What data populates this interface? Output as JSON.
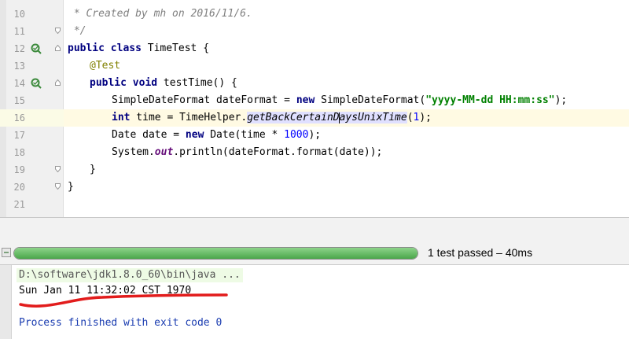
{
  "editor": {
    "lines": [
      {
        "num": "10",
        "comment": " * Created by mh on 2016/11/6."
      },
      {
        "num": "11",
        "comment": " */"
      },
      {
        "num": "12",
        "kw": "public class",
        "rest": " TimeTest {"
      },
      {
        "num": "13",
        "annotation": "@Test"
      },
      {
        "num": "14",
        "kw": "public void",
        "rest": " testTime() {"
      },
      {
        "num": "15",
        "pre": "SimpleDateFormat dateFormat = ",
        "kw": "new",
        "mid": " SimpleDateFormat(",
        "str": "\"yyyy-MM-dd HH:mm:ss\"",
        "post": ");"
      },
      {
        "num": "16",
        "kw": "int",
        "pre": " time = TimeHelper.",
        "method_a": "getBackCertainD",
        "method_b": "aysUnixTime",
        "mid": "(",
        "numval": "1",
        "post": ");"
      },
      {
        "num": "17",
        "pre": "Date date = ",
        "kw": "new",
        "mid": " Date(time * ",
        "numval": "1000",
        "post": ");"
      },
      {
        "num": "18",
        "pre": "System.",
        "static": "out",
        "post": ".println(dateFormat.format(date));"
      },
      {
        "num": "19",
        "rest": "}"
      },
      {
        "num": "20",
        "rest": "}"
      },
      {
        "num": "21"
      }
    ],
    "gutter_icon": "run-test-icon"
  },
  "test_bar": {
    "status": "1 test passed – 40ms",
    "progress": 1.0,
    "progress_color": "#5cb85c",
    "icon": "test-status-icon"
  },
  "console": {
    "command": "D:\\software\\jdk1.8.0_60\\bin\\java ...",
    "output": "Sun Jan 11 11:32:02 CST 1970",
    "exit": "Process finished with exit code 0",
    "annotation_color": "#e21c1c"
  }
}
